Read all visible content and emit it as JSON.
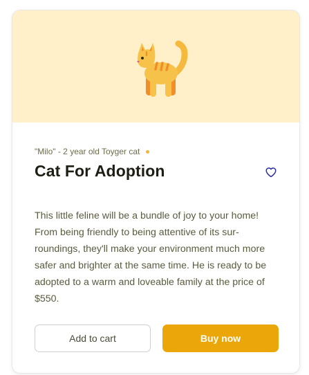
{
  "card": {
    "image_icon": "cat-icon",
    "meta": "\"Milo\" - 2 year old Toyger cat",
    "title": "Cat For Adoption",
    "favorite_icon": "heart-outline-icon",
    "description": "This little feline will be a bundle of joy to your home! From being friendly to being attentive of its sur-roundings, they'll make your environment much more safer and brighter at the same time. He is ready to be adopted to a warm and loveable family at the price of $550.",
    "add_to_cart_label": "Add to cart",
    "buy_now_label": "Buy now"
  },
  "colors": {
    "hero_background": "#fff0c9",
    "accent": "#eba60a",
    "heart": "#2a2aa6"
  }
}
